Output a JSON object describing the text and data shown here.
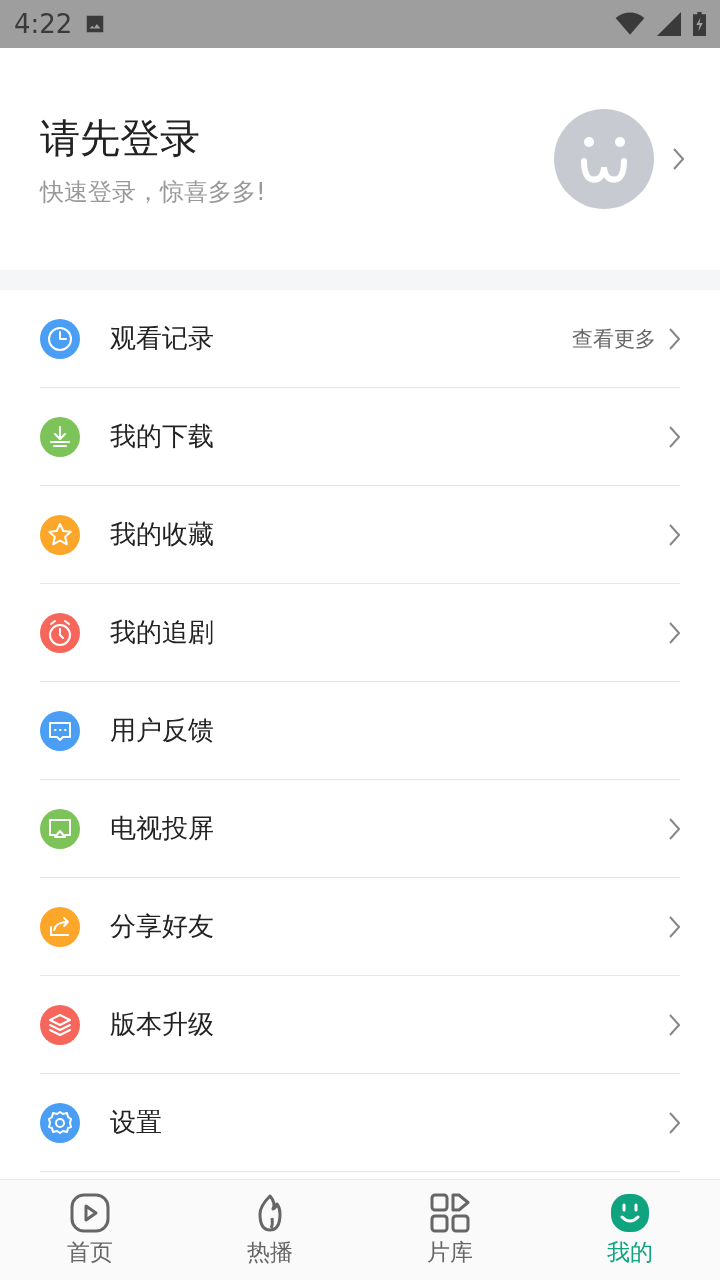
{
  "status_bar": {
    "time": "4:22"
  },
  "profile": {
    "title": "请先登录",
    "subtitle": "快速登录，惊喜多多!"
  },
  "menu": [
    {
      "kind": "clock",
      "label": "观看记录",
      "color": "#4a9ff5",
      "more": "查看更多",
      "arrow": true
    },
    {
      "kind": "download",
      "label": "我的下载",
      "color": "#7cc45a",
      "arrow": true
    },
    {
      "kind": "star",
      "label": "我的收藏",
      "color": "#fca62a",
      "arrow": true
    },
    {
      "kind": "alarm",
      "label": "我的追剧",
      "color": "#f7665b",
      "arrow": true
    },
    {
      "kind": "chat",
      "label": "用户反馈",
      "color": "#4a9ff5",
      "arrow": false
    },
    {
      "kind": "cast",
      "label": "电视投屏",
      "color": "#7cc45a",
      "arrow": true
    },
    {
      "kind": "share",
      "label": "分享好友",
      "color": "#fca62a",
      "arrow": true
    },
    {
      "kind": "layers",
      "label": "版本升级",
      "color": "#f7665b",
      "arrow": true
    },
    {
      "kind": "gear",
      "label": "设置",
      "color": "#4a9ff5",
      "arrow": true
    }
  ],
  "tabs": [
    {
      "kind": "home",
      "label": "首页",
      "selected": false
    },
    {
      "kind": "hot",
      "label": "热播",
      "selected": false
    },
    {
      "kind": "library",
      "label": "片库",
      "selected": false
    },
    {
      "kind": "me",
      "label": "我的",
      "selected": true
    }
  ]
}
